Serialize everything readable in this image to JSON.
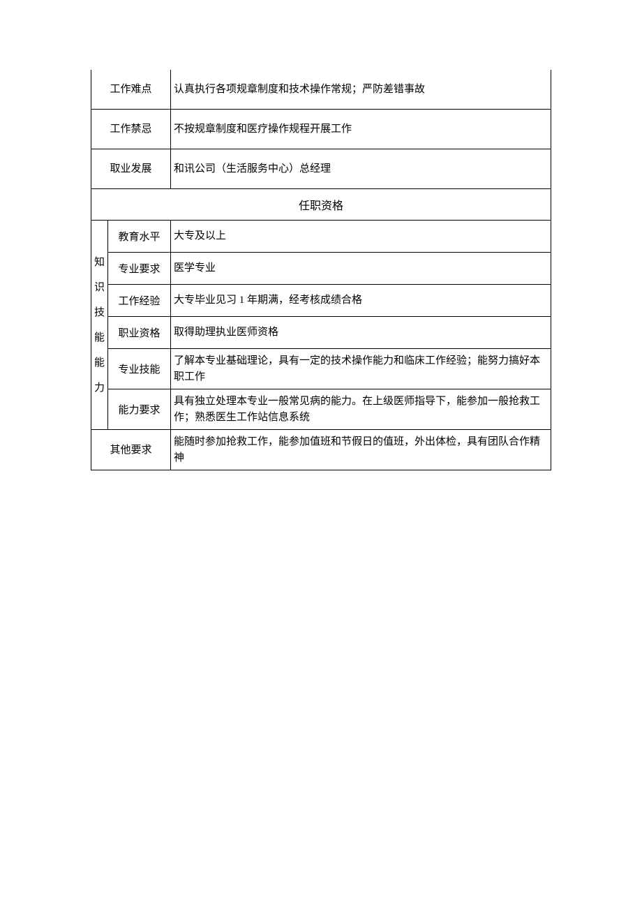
{
  "rows": [
    {
      "label": "工作难点",
      "content": "认真执行各项规章制度和技术操作常规；严防差错事故"
    },
    {
      "label": "工作禁忌",
      "content": "不按规章制度和医疗操作规程开展工作"
    },
    {
      "label": "取业发展",
      "content": "和讯公司（生活服务中心）总经理"
    }
  ],
  "section_header": "任职资格",
  "knowledge_label": "知识技能能力",
  "knowledge_rows": [
    {
      "sub": "教育水平",
      "content": "大专及以上"
    },
    {
      "sub": "专业要求",
      "content": "医学专业"
    },
    {
      "sub": "工作经验",
      "content": "大专毕业见习 1 年期满，经考核成绩合格"
    },
    {
      "sub": "职业资格",
      "content": "取得助理执业医师资格"
    },
    {
      "sub": "专业技能",
      "content": "了解本专业基础理论，具有一定的技术操作能力和临床工作经验；能努力搞好本职工作"
    },
    {
      "sub": "能力要求",
      "content": "具有独立处理本专业一般常见病的能力。在上级医师指导下，能参加一般抢救工作；熟悉医生工作站信息系统"
    }
  ],
  "other_req_label": "其他要求",
  "other_req_content": "能随时参加抢救工作，能参加值班和节假日的值班，外出体检，具有团队合作精神"
}
